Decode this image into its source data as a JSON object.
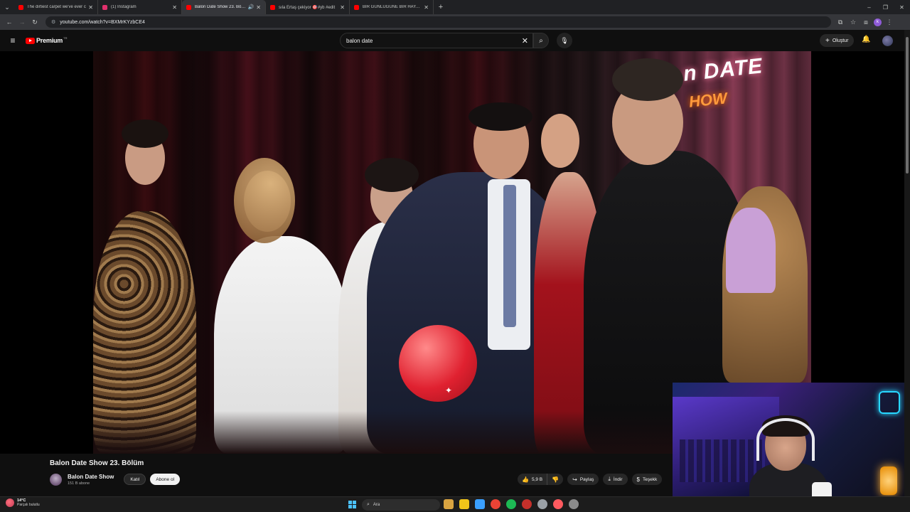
{
  "browser": {
    "tabs": [
      {
        "title": "The dirtiest carpet we've ever c",
        "favicon_color": "#ff0000",
        "active": false,
        "audio": false
      },
      {
        "title": "(1) Instagram",
        "favicon_color": "#e1306c",
        "active": false,
        "audio": false
      },
      {
        "title": "Balon Date Show 23. Bölüm",
        "favicon_color": "#ff0000",
        "active": true,
        "audio": true
      },
      {
        "title": "sıla Ertaş çekiyor 🎯#yb #edit",
        "favicon_color": "#ff0000",
        "active": false,
        "audio": false
      },
      {
        "title": "BİR GÜNLÜĞÜNE BİR HAYATI D",
        "favicon_color": "#ff0000",
        "active": false,
        "audio": false
      }
    ],
    "url": "youtube.com/watch?v=BXMrKYzbCE4"
  },
  "youtube": {
    "brand": "Premium",
    "country_code": "TR",
    "search_value": "balon date",
    "create_label": "Oluştur"
  },
  "video": {
    "title": "Balon Date Show 23. Bölüm",
    "neon_line1": "n DATE",
    "neon_line2": "HOW",
    "channel": {
      "name": "Balon Date Show",
      "subscribers": "151 B abone",
      "join_label": "Katıl",
      "subscribe_label": "Abone ol"
    },
    "actions": {
      "likes": "5,9 B",
      "share_label": "Paylaş",
      "download_label": "İndir",
      "thanks_label": "Teşekk"
    }
  },
  "taskbar": {
    "weather_temp": "14°C",
    "weather_desc": "Parçalı bulutlu",
    "search_placeholder": "Ara",
    "app_colors": [
      "#d9a441",
      "#f0c419",
      "#3aa0ff",
      "#ea4335",
      "#1db954",
      "#c4302b",
      "#9aa0a6",
      "#ff5a5f",
      "#8b8b8b"
    ]
  },
  "colors": {
    "accent": "#ff0000",
    "background": "#0f0f0f"
  }
}
